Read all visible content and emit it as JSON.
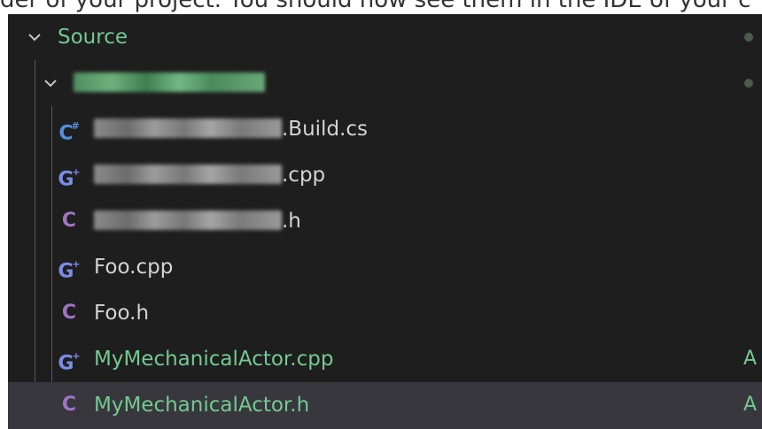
{
  "window": {
    "caption_fragment": "der of your project. You should now see them in the IDE of your c"
  },
  "explorer": {
    "tree": [
      {
        "label": "Source",
        "kind": "folder",
        "expanded": true,
        "decoration": "dot"
      },
      {
        "label": "",
        "kind": "folder",
        "expanded": true,
        "decoration": "dot",
        "name_hidden": true
      },
      {
        "label": ".Build.cs",
        "kind": "file",
        "icon": "csharp-file-icon"
      },
      {
        "label": ".cpp",
        "kind": "file",
        "icon": "cpp-file-icon"
      },
      {
        "label": ".h",
        "kind": "file",
        "icon": "header-file-icon"
      },
      {
        "label": "Foo.cpp",
        "kind": "file",
        "icon": "cpp-file-icon"
      },
      {
        "label": "Foo.h",
        "kind": "file",
        "icon": "header-file-icon"
      },
      {
        "label": "MyMechanicalActor.cpp",
        "kind": "file",
        "icon": "cpp-file-icon",
        "git_status": "A"
      },
      {
        "label": "MyMechanicalActor.h",
        "kind": "file",
        "icon": "header-file-icon",
        "git_status": "A",
        "selected": true
      }
    ],
    "icon_glyphs": {
      "cs": "C",
      "cs_sup": "#",
      "cpp": "G",
      "cpp_sup": "+",
      "h": "C"
    },
    "colors": {
      "background": "#1e1e1e",
      "selected_row": "#37373d",
      "added_green": "#73c991",
      "default_text": "#d4d4d4",
      "indent_guide": "#585858"
    }
  }
}
